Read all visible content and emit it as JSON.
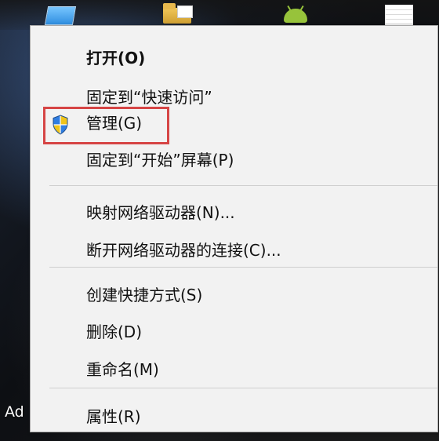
{
  "desktop": {
    "bottom_text": "Ad"
  },
  "context_menu": {
    "items": [
      {
        "label": "打开(O)",
        "bold": true
      },
      {
        "label": "固定到“快速访问”",
        "bold": false
      },
      {
        "label": "管理(G)",
        "bold": false,
        "icon": "uac-shield-icon"
      },
      {
        "label": "固定到“开始”屏幕(P)",
        "bold": false
      },
      {
        "label": "映射网络驱动器(N)...",
        "bold": false
      },
      {
        "label": "断开网络驱动器的连接(C)...",
        "bold": false
      },
      {
        "label": "创建快捷方式(S)",
        "bold": false
      },
      {
        "label": "删除(D)",
        "bold": false
      },
      {
        "label": "重命名(M)",
        "bold": false
      },
      {
        "label": "属性(R)",
        "bold": false
      }
    ]
  },
  "colors": {
    "menu_background": "#f2f2f2",
    "menu_border": "#a8a8a8",
    "separator": "#cfcfcf",
    "highlight_border": "#d64545",
    "text": "#111111"
  }
}
